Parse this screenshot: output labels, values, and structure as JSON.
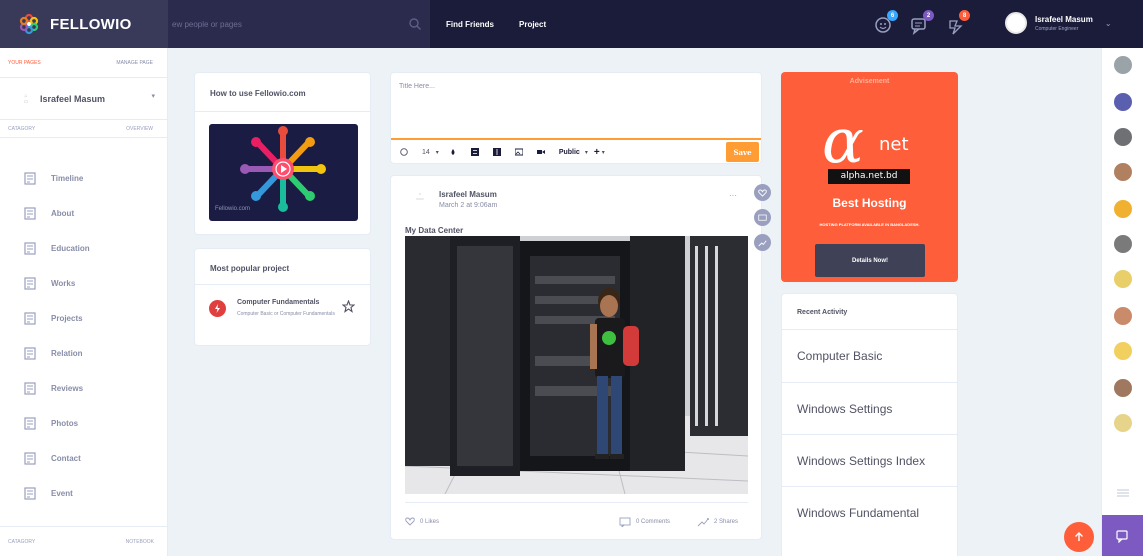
{
  "brand": {
    "name": "FELLOWIO"
  },
  "search": {
    "placeholder": "ew people or pages"
  },
  "topnav": {
    "items": [
      "Find Friends",
      "Project"
    ]
  },
  "notifications": {
    "friends_count": "6",
    "messages_count": "2",
    "alerts_count": "8"
  },
  "user": {
    "name": "Israfeel Masum",
    "role": "Computer Engineer"
  },
  "leftside": {
    "your_pages": "YOUR PAGES",
    "manage_page": "MANAGE PAGE",
    "page_name": "Israfeel Masum",
    "category": "CATAGORY",
    "overview": "OVERVIEW",
    "menu": [
      "Timeline",
      "About",
      "Education",
      "Works",
      "Projects",
      "Relation",
      "Reviews",
      "Photos",
      "Contact",
      "Event"
    ],
    "footer_left": "CATAGORY",
    "footer_right": "NOTEBOOK"
  },
  "howto": {
    "title": "How to use Fellowio.com",
    "video_caption": "Fellowio.com"
  },
  "popular": {
    "title": "Most popular project",
    "item_title": "Computer Fundamentals",
    "item_sub": "Computer Basic or Computer Fundamentals"
  },
  "composer": {
    "placeholder": "Title Here...",
    "font_size": "14",
    "privacy": "Public",
    "save_label": "Save"
  },
  "post": {
    "author": "Israfeel Masum",
    "date": "March 2 at 9:06am",
    "title": "My Data Center",
    "likes": "0 Likes",
    "comments": "0 Comments",
    "shares": "2 Shares",
    "more": "···"
  },
  "ad": {
    "header": "Advisement",
    "brand": "net",
    "url": "alpha.net.bd",
    "headline": "Best Hosting",
    "subline": "HOSTING PLATFORM AVAILABLE IN BANGLADESH.",
    "button": "Details Now!"
  },
  "recent": {
    "title": "Recent Activity",
    "items": [
      "Computer Basic",
      "Windows Settings",
      "Windows Settings Index",
      "Windows Fundamental"
    ]
  },
  "colors": {
    "accent": "#ff5e3a",
    "save": "#ff9c33",
    "topbar": "#1b1c3a",
    "purple": "#7c5ac2"
  }
}
